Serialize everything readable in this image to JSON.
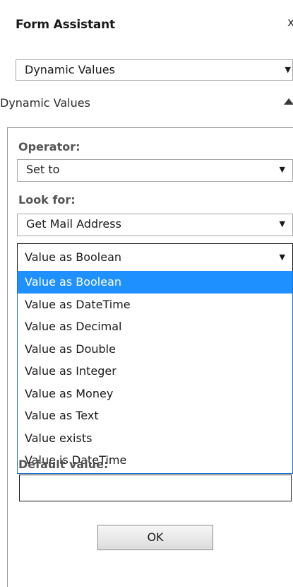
{
  "panel": {
    "title": "Form Assistant",
    "close_glyph": "x",
    "form_type_select": {
      "value": "Dynamic Values"
    },
    "section": {
      "header": "Dynamic Values",
      "collapse_icon": "chevron-up-icon"
    }
  },
  "form": {
    "operator_label": "Operator:",
    "operator_value": "Set to",
    "lookfor_label": "Look for:",
    "lookfor_value": "Get Mail Address",
    "value_type": {
      "value": "Value as Boolean",
      "options": [
        "Value as Boolean",
        "Value as DateTime",
        "Value as Decimal",
        "Value as Double",
        "Value as Integer",
        "Value as Money",
        "Value as Text",
        "Value exists",
        "Value is DateTime"
      ]
    },
    "default_label": "Default value:",
    "default_value": "",
    "ok_label": "OK"
  },
  "colors": {
    "highlight": "#1e90ff",
    "dropdown_border": "#1a73d4"
  }
}
